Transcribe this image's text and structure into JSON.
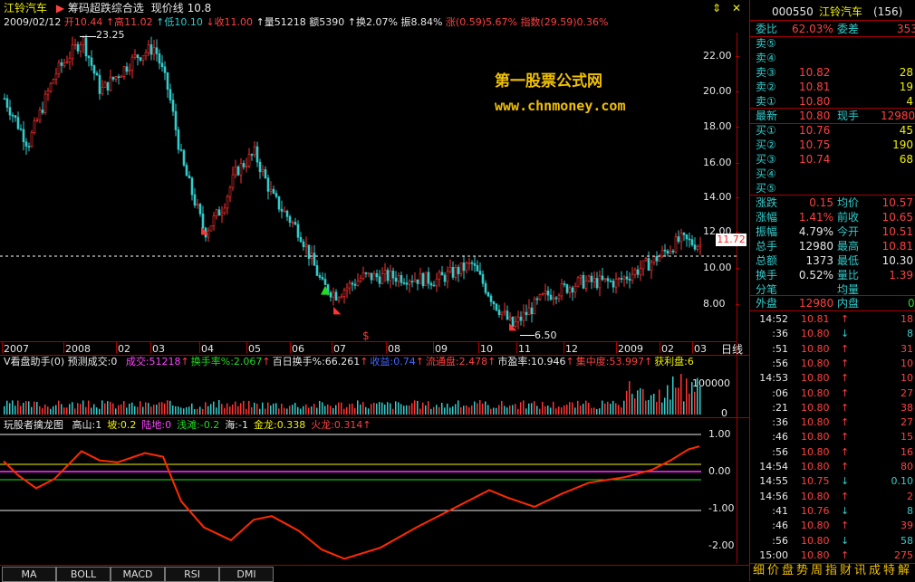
{
  "header": {
    "stock_name": "江铃汽车",
    "indicator_name": "筹码超跌综合选",
    "current_line_label": "现价线",
    "current_line_value": "10.8"
  },
  "quote_line": {
    "date": "2009/02/12",
    "open": "开10.44",
    "high": "高11.02",
    "low": "低10.10",
    "close": "收11.00",
    "volume": "量51218",
    "amount": "额5390",
    "turnover": "换2.07%",
    "amplitude": "振8.84%",
    "change": "涨(0.59)5.67%",
    "index": "指数(29.59)0.36%"
  },
  "main_chart": {
    "y_axis_labels": [
      "22.00",
      "20.00",
      "18.00",
      "16.00",
      "14.00",
      "12.00",
      "10.00",
      "8.00"
    ],
    "current_price_tag": "11.72",
    "high_marker": "23.25",
    "low_marker": "6.50",
    "watermark_title": "第一股票公式网",
    "watermark_url": "www.chnmoney.com",
    "dollar_mark": "$",
    "x_axis_labels": [
      "2007",
      "2008",
      "02",
      "03",
      "04",
      "05",
      "06",
      "07",
      "08",
      "09",
      "10",
      "11",
      "12",
      "2009",
      "02",
      "03"
    ],
    "period_label": "日线"
  },
  "volume_panel": {
    "title": "V看盘助手(0)",
    "forecast": "预测成交:0",
    "items": [
      {
        "text": "成交:51218",
        "color": "#ff44ff"
      },
      {
        "text": "换手率%:2.067",
        "color": "#22dd22"
      },
      {
        "text": "百日换手%:66.261",
        "color": "#e8e8e8"
      },
      {
        "text": "收益:0.74",
        "color": "#4466ff"
      },
      {
        "text": "流通盘:2.478",
        "color": "#ff4040"
      },
      {
        "text": "市盈率:10.946",
        "color": "#e8e8e8"
      },
      {
        "text": "集中度:53.997",
        "color": "#ff4040"
      },
      {
        "text": "获利盘:6",
        "color": "#f0f000"
      }
    ],
    "axis_top": "100000",
    "axis_bottom": "0"
  },
  "dragon_panel": {
    "title": "玩股者擒龙图",
    "items": [
      {
        "text": "高山:1",
        "color": "#e8e8e8"
      },
      {
        "text": "坡:0.2",
        "color": "#f0f000"
      },
      {
        "text": "陆地:0",
        "color": "#ff44ff"
      },
      {
        "text": "浅滩:-0.2",
        "color": "#22dd22"
      },
      {
        "text": "海:-1",
        "color": "#e8e8e8"
      },
      {
        "text": "金龙:0.338",
        "color": "#f0f000"
      },
      {
        "text": "火龙:0.314",
        "color": "#ff4040"
      }
    ],
    "y_axis_labels": [
      "1.00",
      "0.00",
      "-1.00",
      "-2.00"
    ]
  },
  "bottom_tabs": [
    "MA",
    "BOLL",
    "MACD",
    "RSI",
    "DMI"
  ],
  "right_panel": {
    "code": "000550",
    "name": "江铃汽车",
    "count": "(156)",
    "weibi_label": "委比",
    "weibi_value": "62.03%",
    "weicha_label": "委差",
    "weicha_value": "353",
    "sell": [
      {
        "label": "卖⑤",
        "price": "",
        "vol": ""
      },
      {
        "label": "卖④",
        "price": "",
        "vol": ""
      },
      {
        "label": "卖③",
        "price": "10.82",
        "vol": "28"
      },
      {
        "label": "卖②",
        "price": "10.81",
        "vol": "19"
      },
      {
        "label": "卖①",
        "price": "10.80",
        "vol": "4"
      }
    ],
    "latest_label": "最新",
    "latest_value": "10.80",
    "xianshou_label": "现手",
    "xianshou_value": "12980",
    "buy": [
      {
        "label": "买①",
        "price": "10.76",
        "vol": "45"
      },
      {
        "label": "买②",
        "price": "10.75",
        "vol": "190"
      },
      {
        "label": "买③",
        "price": "10.74",
        "vol": "68"
      },
      {
        "label": "买④",
        "price": "",
        "vol": ""
      },
      {
        "label": "买⑤",
        "price": "",
        "vol": ""
      }
    ],
    "stats": [
      {
        "l1": "涨跌",
        "v1": "0.15",
        "l2": "均价",
        "v2": "10.57"
      },
      {
        "l1": "涨幅",
        "v1": "1.41%",
        "l2": "前收",
        "v2": "10.65"
      },
      {
        "l1": "振幅",
        "v1": "4.79%",
        "l2": "今开",
        "v2": "10.51"
      },
      {
        "l1": "总手",
        "v1": "12980",
        "l2": "最高",
        "v2": "10.81"
      },
      {
        "l1": "总额",
        "v1": "1373",
        "l2": "最低",
        "v2": "10.30"
      },
      {
        "l1": "换手",
        "v1": "0.52%",
        "l2": "量比",
        "v2": "1.39"
      },
      {
        "l1": "分笔",
        "v1": "",
        "l2": "均量",
        "v2": ""
      }
    ],
    "waipan_label": "外盘",
    "waipan_value": "12980",
    "neipan_label": "内盘",
    "neipan_value": "0",
    "ticks": [
      {
        "time": "14:52",
        "price": "10.81",
        "dir": "up",
        "vol": "18"
      },
      {
        "time": ":36",
        "price": "10.80",
        "dir": "down",
        "vol": "8"
      },
      {
        "time": ":51",
        "price": "10.80",
        "dir": "up",
        "vol": "31"
      },
      {
        "time": ":56",
        "price": "10.80",
        "dir": "up",
        "vol": "10"
      },
      {
        "time": "14:53",
        "price": "10.80",
        "dir": "up",
        "vol": "10"
      },
      {
        "time": ":06",
        "price": "10.80",
        "dir": "up",
        "vol": "27"
      },
      {
        "time": ":21",
        "price": "10.80",
        "dir": "up",
        "vol": "38"
      },
      {
        "time": ":36",
        "price": "10.80",
        "dir": "up",
        "vol": "27"
      },
      {
        "time": ":46",
        "price": "10.80",
        "dir": "up",
        "vol": "15"
      },
      {
        "time": ":56",
        "price": "10.80",
        "dir": "up",
        "vol": "16"
      },
      {
        "time": "14:54",
        "price": "10.80",
        "dir": "up",
        "vol": "80"
      },
      {
        "time": "14:55",
        "price": "10.75",
        "dir": "down",
        "vol": "0.10"
      },
      {
        "time": "14:56",
        "price": "10.80",
        "dir": "up",
        "vol": "2"
      },
      {
        "time": ":41",
        "price": "10.76",
        "dir": "down",
        "vol": "8"
      },
      {
        "time": ":46",
        "price": "10.80",
        "dir": "up",
        "vol": "39"
      },
      {
        "time": ":56",
        "price": "10.80",
        "dir": "down",
        "vol": "58"
      },
      {
        "time": "15:00",
        "price": "10.80",
        "dir": "up",
        "vol": "275"
      }
    ],
    "footer_tabs": [
      "细",
      "价",
      "盘",
      "势",
      "周",
      "指",
      "财",
      "讯",
      "成",
      "特",
      "解"
    ]
  }
}
